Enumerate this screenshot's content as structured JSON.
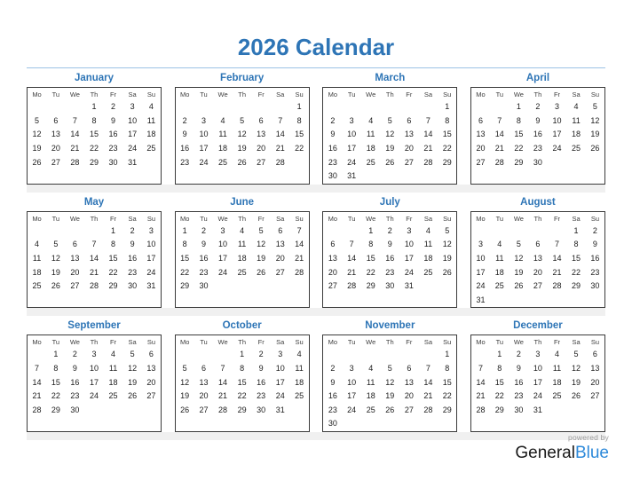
{
  "document": {
    "title": "2026 Calendar",
    "year": 2026,
    "week_start": "Monday",
    "accent_color": "#2e75b6",
    "rule_color": "#9cc3e5",
    "band_color": "#f0f0f0"
  },
  "weekday_headers": [
    "Mo",
    "Tu",
    "We",
    "Th",
    "Fr",
    "Sa",
    "Su"
  ],
  "months": [
    {
      "name": "January",
      "days": 31,
      "start_weekday_index": 3,
      "weeks": [
        [
          "",
          "",
          "",
          "1",
          "2",
          "3",
          "4"
        ],
        [
          "5",
          "6",
          "7",
          "8",
          "9",
          "10",
          "11"
        ],
        [
          "12",
          "13",
          "14",
          "15",
          "16",
          "17",
          "18"
        ],
        [
          "19",
          "20",
          "21",
          "22",
          "23",
          "24",
          "25"
        ],
        [
          "26",
          "27",
          "28",
          "29",
          "30",
          "31",
          ""
        ],
        [
          "",
          "",
          "",
          "",
          "",
          "",
          ""
        ]
      ]
    },
    {
      "name": "February",
      "days": 28,
      "start_weekday_index": 6,
      "weeks": [
        [
          "",
          "",
          "",
          "",
          "",
          "",
          "1"
        ],
        [
          "2",
          "3",
          "4",
          "5",
          "6",
          "7",
          "8"
        ],
        [
          "9",
          "10",
          "11",
          "12",
          "13",
          "14",
          "15"
        ],
        [
          "16",
          "17",
          "18",
          "19",
          "20",
          "21",
          "22"
        ],
        [
          "23",
          "24",
          "25",
          "26",
          "27",
          "28",
          ""
        ],
        [
          "",
          "",
          "",
          "",
          "",
          "",
          ""
        ]
      ]
    },
    {
      "name": "March",
      "days": 31,
      "start_weekday_index": 6,
      "weeks": [
        [
          "",
          "",
          "",
          "",
          "",
          "",
          "1"
        ],
        [
          "2",
          "3",
          "4",
          "5",
          "6",
          "7",
          "8"
        ],
        [
          "9",
          "10",
          "11",
          "12",
          "13",
          "14",
          "15"
        ],
        [
          "16",
          "17",
          "18",
          "19",
          "20",
          "21",
          "22"
        ],
        [
          "23",
          "24",
          "25",
          "26",
          "27",
          "28",
          "29"
        ],
        [
          "30",
          "31",
          "",
          "",
          "",
          "",
          ""
        ]
      ]
    },
    {
      "name": "April",
      "days": 30,
      "start_weekday_index": 2,
      "weeks": [
        [
          "",
          "",
          "1",
          "2",
          "3",
          "4",
          "5"
        ],
        [
          "6",
          "7",
          "8",
          "9",
          "10",
          "11",
          "12"
        ],
        [
          "13",
          "14",
          "15",
          "16",
          "17",
          "18",
          "19"
        ],
        [
          "20",
          "21",
          "22",
          "23",
          "24",
          "25",
          "26"
        ],
        [
          "27",
          "28",
          "29",
          "30",
          "",
          "",
          ""
        ],
        [
          "",
          "",
          "",
          "",
          "",
          "",
          ""
        ]
      ]
    },
    {
      "name": "May",
      "days": 31,
      "start_weekday_index": 4,
      "weeks": [
        [
          "",
          "",
          "",
          "",
          "1",
          "2",
          "3"
        ],
        [
          "4",
          "5",
          "6",
          "7",
          "8",
          "9",
          "10"
        ],
        [
          "11",
          "12",
          "13",
          "14",
          "15",
          "16",
          "17"
        ],
        [
          "18",
          "19",
          "20",
          "21",
          "22",
          "23",
          "24"
        ],
        [
          "25",
          "26",
          "27",
          "28",
          "29",
          "30",
          "31"
        ],
        [
          "",
          "",
          "",
          "",
          "",
          "",
          ""
        ]
      ]
    },
    {
      "name": "June",
      "days": 30,
      "start_weekday_index": 0,
      "weeks": [
        [
          "1",
          "2",
          "3",
          "4",
          "5",
          "6",
          "7"
        ],
        [
          "8",
          "9",
          "10",
          "11",
          "12",
          "13",
          "14"
        ],
        [
          "15",
          "16",
          "17",
          "18",
          "19",
          "20",
          "21"
        ],
        [
          "22",
          "23",
          "24",
          "25",
          "26",
          "27",
          "28"
        ],
        [
          "29",
          "30",
          "",
          "",
          "",
          "",
          ""
        ],
        [
          "",
          "",
          "",
          "",
          "",
          "",
          ""
        ]
      ]
    },
    {
      "name": "July",
      "days": 31,
      "start_weekday_index": 2,
      "weeks": [
        [
          "",
          "",
          "1",
          "2",
          "3",
          "4",
          "5"
        ],
        [
          "6",
          "7",
          "8",
          "9",
          "10",
          "11",
          "12"
        ],
        [
          "13",
          "14",
          "15",
          "16",
          "17",
          "18",
          "19"
        ],
        [
          "20",
          "21",
          "22",
          "23",
          "24",
          "25",
          "26"
        ],
        [
          "27",
          "28",
          "29",
          "30",
          "31",
          "",
          ""
        ],
        [
          "",
          "",
          "",
          "",
          "",
          "",
          ""
        ]
      ]
    },
    {
      "name": "August",
      "days": 31,
      "start_weekday_index": 5,
      "weeks": [
        [
          "",
          "",
          "",
          "",
          "",
          "1",
          "2"
        ],
        [
          "3",
          "4",
          "5",
          "6",
          "7",
          "8",
          "9"
        ],
        [
          "10",
          "11",
          "12",
          "13",
          "14",
          "15",
          "16"
        ],
        [
          "17",
          "18",
          "19",
          "20",
          "21",
          "22",
          "23"
        ],
        [
          "24",
          "25",
          "26",
          "27",
          "28",
          "29",
          "30"
        ],
        [
          "31",
          "",
          "",
          "",
          "",
          "",
          ""
        ]
      ]
    },
    {
      "name": "September",
      "days": 30,
      "start_weekday_index": 1,
      "weeks": [
        [
          "",
          "1",
          "2",
          "3",
          "4",
          "5",
          "6"
        ],
        [
          "7",
          "8",
          "9",
          "10",
          "11",
          "12",
          "13"
        ],
        [
          "14",
          "15",
          "16",
          "17",
          "18",
          "19",
          "20"
        ],
        [
          "21",
          "22",
          "23",
          "24",
          "25",
          "26",
          "27"
        ],
        [
          "28",
          "29",
          "30",
          "",
          "",
          "",
          ""
        ],
        [
          "",
          "",
          "",
          "",
          "",
          "",
          ""
        ]
      ]
    },
    {
      "name": "October",
      "days": 31,
      "start_weekday_index": 3,
      "weeks": [
        [
          "",
          "",
          "",
          "1",
          "2",
          "3",
          "4"
        ],
        [
          "5",
          "6",
          "7",
          "8",
          "9",
          "10",
          "11"
        ],
        [
          "12",
          "13",
          "14",
          "15",
          "16",
          "17",
          "18"
        ],
        [
          "19",
          "20",
          "21",
          "22",
          "23",
          "24",
          "25"
        ],
        [
          "26",
          "27",
          "28",
          "29",
          "30",
          "31",
          ""
        ],
        [
          "",
          "",
          "",
          "",
          "",
          "",
          ""
        ]
      ]
    },
    {
      "name": "November",
      "days": 30,
      "start_weekday_index": 6,
      "weeks": [
        [
          "",
          "",
          "",
          "",
          "",
          "",
          "1"
        ],
        [
          "2",
          "3",
          "4",
          "5",
          "6",
          "7",
          "8"
        ],
        [
          "9",
          "10",
          "11",
          "12",
          "13",
          "14",
          "15"
        ],
        [
          "16",
          "17",
          "18",
          "19",
          "20",
          "21",
          "22"
        ],
        [
          "23",
          "24",
          "25",
          "26",
          "27",
          "28",
          "29"
        ],
        [
          "30",
          "",
          "",
          "",
          "",
          "",
          ""
        ]
      ]
    },
    {
      "name": "December",
      "days": 31,
      "start_weekday_index": 1,
      "weeks": [
        [
          "",
          "1",
          "2",
          "3",
          "4",
          "5",
          "6"
        ],
        [
          "7",
          "8",
          "9",
          "10",
          "11",
          "12",
          "13"
        ],
        [
          "14",
          "15",
          "16",
          "17",
          "18",
          "19",
          "20"
        ],
        [
          "21",
          "22",
          "23",
          "24",
          "25",
          "26",
          "27"
        ],
        [
          "28",
          "29",
          "30",
          "31",
          "",
          "",
          ""
        ],
        [
          "",
          "",
          "",
          "",
          "",
          "",
          ""
        ]
      ]
    }
  ],
  "footer": {
    "powered_by": "powered by",
    "brand_part1": "General",
    "brand_part2": "Blue"
  }
}
